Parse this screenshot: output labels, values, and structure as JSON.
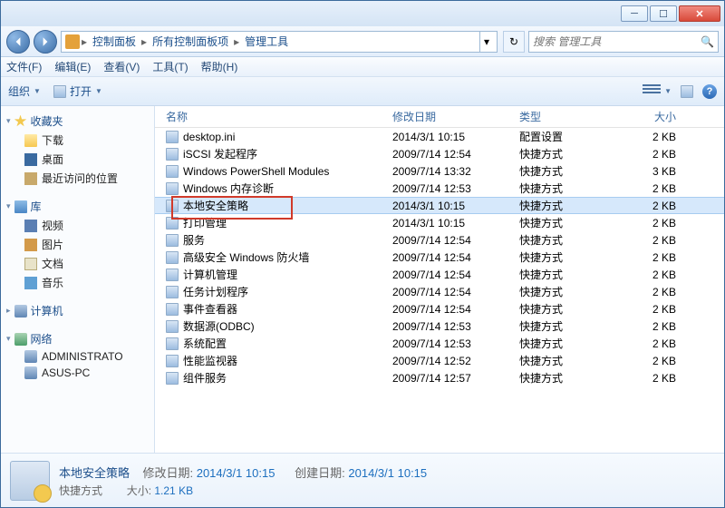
{
  "breadcrumb": {
    "root": "控制面板",
    "mid": "所有控制面板项",
    "leaf": "管理工具"
  },
  "search": {
    "placeholder": "搜索 管理工具"
  },
  "menubar": {
    "file": "文件(F)",
    "edit": "编辑(E)",
    "view": "查看(V)",
    "tools": "工具(T)",
    "help": "帮助(H)"
  },
  "toolbar": {
    "organize": "组织",
    "open": "打开"
  },
  "nav": {
    "favorites": "收藏夹",
    "downloads": "下载",
    "desktop": "桌面",
    "recent": "最近访问的位置",
    "libraries": "库",
    "videos": "视频",
    "pictures": "图片",
    "documents": "文档",
    "music": "音乐",
    "computer": "计算机",
    "network": "网络",
    "net_admin": "ADMINISTRATO",
    "net_asus": "ASUS-PC"
  },
  "columns": {
    "name": "名称",
    "modified": "修改日期",
    "type": "类型",
    "size": "大小"
  },
  "files": [
    {
      "name": "desktop.ini",
      "modified": "2014/3/1 10:15",
      "type": "配置设置",
      "size": "2 KB"
    },
    {
      "name": "iSCSI 发起程序",
      "modified": "2009/7/14 12:54",
      "type": "快捷方式",
      "size": "2 KB"
    },
    {
      "name": "Windows PowerShell Modules",
      "modified": "2009/7/14 13:32",
      "type": "快捷方式",
      "size": "3 KB"
    },
    {
      "name": "Windows 内存诊断",
      "modified": "2009/7/14 12:53",
      "type": "快捷方式",
      "size": "2 KB"
    },
    {
      "name": "本地安全策略",
      "modified": "2014/3/1 10:15",
      "type": "快捷方式",
      "size": "2 KB"
    },
    {
      "name": "打印管理",
      "modified": "2014/3/1 10:15",
      "type": "快捷方式",
      "size": "2 KB"
    },
    {
      "name": "服务",
      "modified": "2009/7/14 12:54",
      "type": "快捷方式",
      "size": "2 KB"
    },
    {
      "name": "高级安全 Windows 防火墙",
      "modified": "2009/7/14 12:54",
      "type": "快捷方式",
      "size": "2 KB"
    },
    {
      "name": "计算机管理",
      "modified": "2009/7/14 12:54",
      "type": "快捷方式",
      "size": "2 KB"
    },
    {
      "name": "任务计划程序",
      "modified": "2009/7/14 12:54",
      "type": "快捷方式",
      "size": "2 KB"
    },
    {
      "name": "事件查看器",
      "modified": "2009/7/14 12:54",
      "type": "快捷方式",
      "size": "2 KB"
    },
    {
      "name": "数据源(ODBC)",
      "modified": "2009/7/14 12:53",
      "type": "快捷方式",
      "size": "2 KB"
    },
    {
      "name": "系统配置",
      "modified": "2009/7/14 12:53",
      "type": "快捷方式",
      "size": "2 KB"
    },
    {
      "name": "性能监视器",
      "modified": "2009/7/14 12:52",
      "type": "快捷方式",
      "size": "2 KB"
    },
    {
      "name": "组件服务",
      "modified": "2009/7/14 12:57",
      "type": "快捷方式",
      "size": "2 KB"
    }
  ],
  "details": {
    "title": "本地安全策略",
    "subtitle": "快捷方式",
    "mod_label": "修改日期:",
    "mod_value": "2014/3/1 10:15",
    "created_label": "创建日期:",
    "created_value": "2014/3/1 10:15",
    "size_label": "大小:",
    "size_value": "1.21 KB"
  },
  "selected_index": 4
}
